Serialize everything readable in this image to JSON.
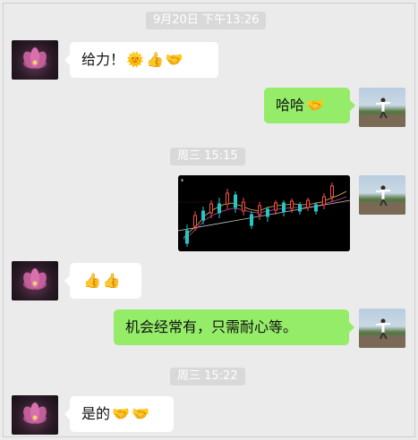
{
  "timestamps": [
    "9月20日 下午13:26",
    "周三 15:15",
    "周三 15:22"
  ],
  "messages": [
    {
      "side": "left",
      "text": "给力！",
      "emojis": [
        "sun-emoji",
        "thumbs-up-emoji",
        "handshake-emoji"
      ]
    },
    {
      "side": "right",
      "text": "哈哈",
      "emojis": [
        "handshake-emoji"
      ]
    },
    {
      "side": "right",
      "type": "image",
      "description_name": "stock-chart-image"
    },
    {
      "side": "left",
      "text": "",
      "emojis": [
        "thumbs-up-emoji",
        "thumbs-up-emoji"
      ]
    },
    {
      "side": "right",
      "text": "机会经常有，只需耐心等。",
      "emojis": []
    },
    {
      "side": "left",
      "text": "是的",
      "emojis": [
        "handshake-emoji",
        "handshake-emoji"
      ]
    }
  ],
  "emoji_glyphs": {
    "sun": "🌞",
    "thumbs_up": "👍",
    "handshake": "🤝"
  },
  "colors": {
    "background": "#ebebeb",
    "sent_bubble": "#95ec69",
    "received_bubble": "#ffffff",
    "timestamp_pill": "#d9d9d9"
  }
}
